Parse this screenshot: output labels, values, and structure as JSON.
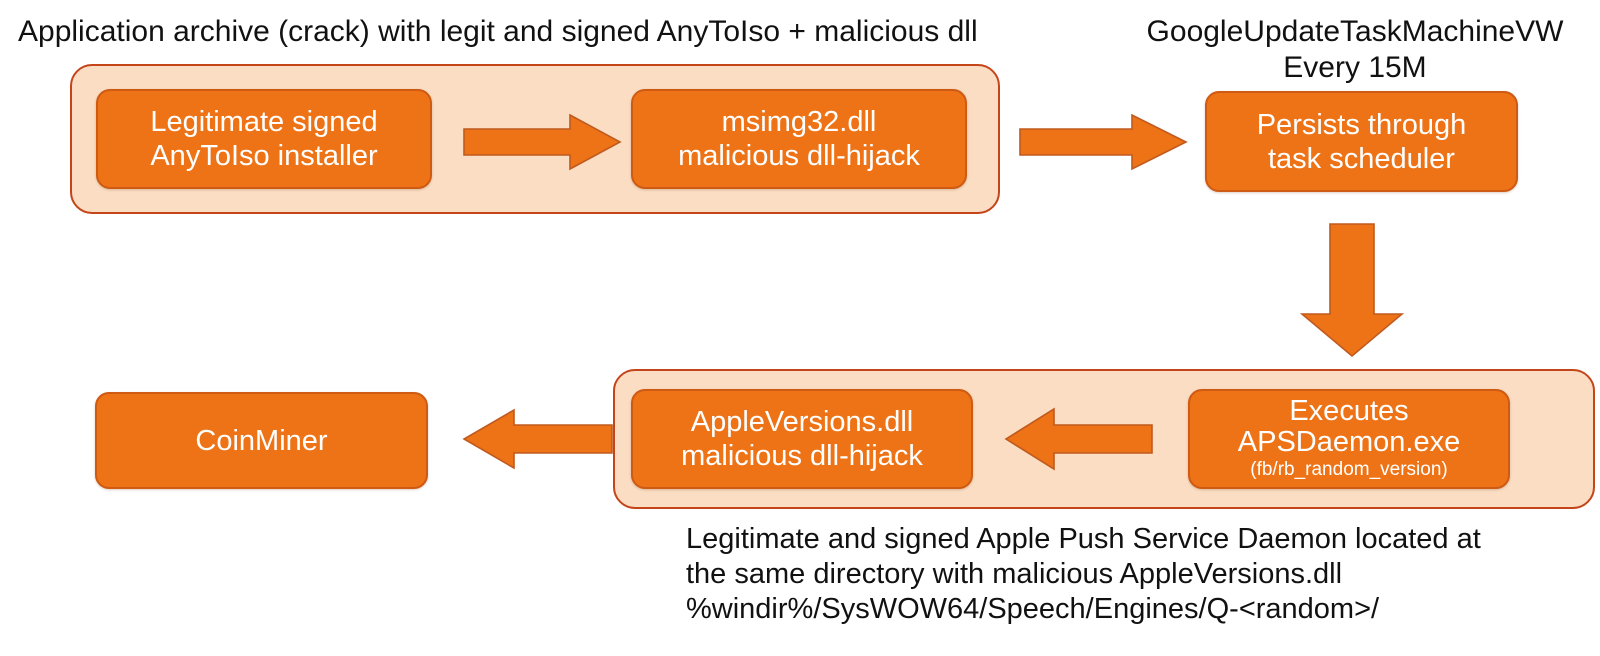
{
  "diagram": {
    "title_top_left": "Application archive (crack) with legit and signed AnyToIso + malicious dll",
    "title_top_right": "GoogleUpdateTaskMachineVW\nEvery 15M",
    "boxes": {
      "legit_installer": "Legitimate signed\nAnyToIso installer",
      "msimg32": "msimg32.dll\nmalicious dll-hijack",
      "persists": "Persists through\ntask scheduler",
      "executes_main": "Executes\nAPSDaemon.exe",
      "executes_sub": "(fb/rb_random_version)",
      "appleversions": "AppleVersions.dll\nmalicious dll-hijack",
      "coinminer": "CoinMiner"
    },
    "bottom_note": "Legitimate and signed Apple Push Service Daemon located at\nthe same directory with malicious AppleVersions.dll\n%windir%/SysWOW64/Speech/Engines/Q-<random>/",
    "colors": {
      "box_fill": "#ED7316",
      "box_border": "#CE5A13",
      "group_fill": "#FADDC3",
      "group_border": "#C5451A",
      "arrow_fill": "#ED7316",
      "arrow_border": "#C05A1E",
      "text_on_box": "#FFFFFF",
      "caption_text": "#111111",
      "background": "#FFFFFF"
    },
    "arrows": {
      "a1": "arrow-right-installer-to-msimg32",
      "a2": "arrow-right-archive-to-scheduler",
      "a3": "arrow-down-scheduler-to-executes",
      "a4": "arrow-left-executes-to-appleversions",
      "a5": "arrow-left-appleversions-to-coinminer"
    }
  }
}
